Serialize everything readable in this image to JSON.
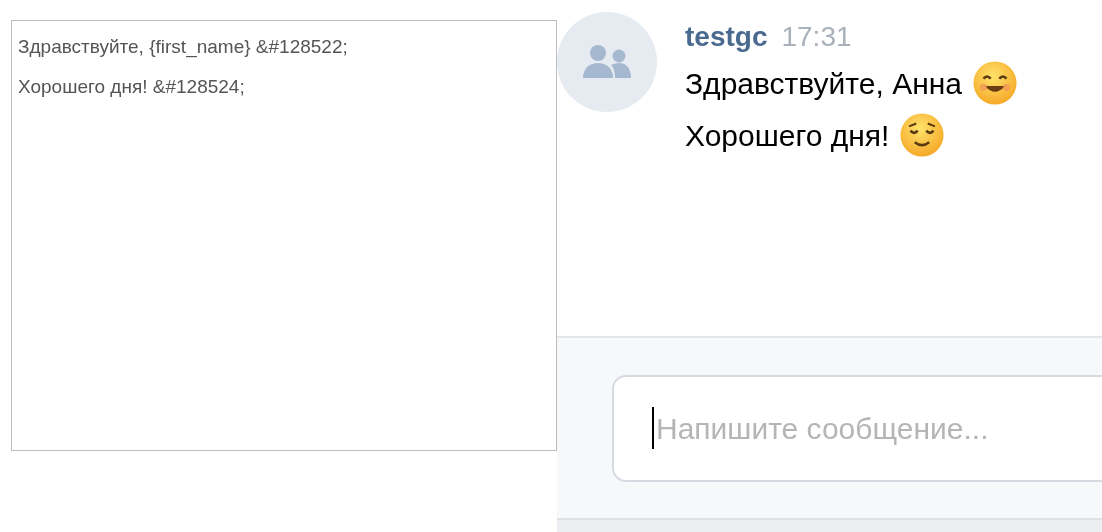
{
  "editor": {
    "lines": [
      "Здравствуйте, {first_name} &#128522;",
      "Хорошего дня! &#128524;"
    ]
  },
  "message": {
    "author": "testgc",
    "time": "17:31",
    "lines": [
      {
        "text": "Здравствуйте, Анна",
        "kind": "smiling"
      },
      {
        "text": "Хорошего дня!",
        "kind": "relieved"
      }
    ]
  },
  "composer": {
    "placeholder": "Напишите сообщение...",
    "focused": true
  }
}
